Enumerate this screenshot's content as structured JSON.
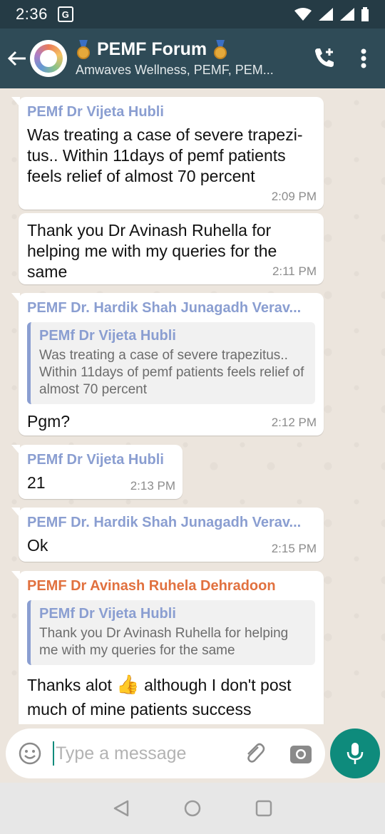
{
  "status_bar": {
    "time": "2:36"
  },
  "header": {
    "title": "PEMF Forum",
    "subtitle": "Amwaves Wellness, PEMF, PEM..."
  },
  "messages": [
    {
      "sender": "PEMf Dr Vijeta Hubli",
      "text": "Was treating a case of severe trapezi-tus..  Within 11days of pemf patients feels relief of almost 70 percent",
      "time": "2:09 PM"
    },
    {
      "text": "Thank you Dr Avinash Ruhella for helping me with my queries for the same",
      "time": "2:11 PM"
    },
    {
      "sender": "PEMF Dr. Hardik Shah Junagadh Verav...",
      "quote_sender": "PEMf Dr Vijeta Hubli",
      "quote_text": "Was treating a case of severe trapezitus.. Within 11days of pemf patients feels relief of almost 70 percent",
      "text": "Pgm?",
      "time": "2:12 PM"
    },
    {
      "sender": "PEMf Dr Vijeta Hubli",
      "text": "21",
      "time": "2:13 PM"
    },
    {
      "sender": "PEMF Dr. Hardik Shah Junagadh Verav...",
      "text": "Ok",
      "time": "2:15 PM"
    },
    {
      "sender": "PEMF Dr Avinash Ruhela Dehradoon",
      "quote_sender": "PEMf Dr Vijeta Hubli",
      "quote_text": "Thank you Dr Avinash Ruhella for helping me with my queries for the same",
      "text_before_emoji": "Thanks alot",
      "text_after_emoji": "although I don't post much of mine patients success"
    }
  ],
  "composer": {
    "placeholder": "Type a message"
  },
  "colors": {
    "header": "#2f4b57",
    "accent": "#0e8b7c",
    "sender_blue": "#8a9ed1",
    "sender_orange": "#e1713f"
  },
  "icons": [
    "back-arrow-icon",
    "medal-icon",
    "add-call-icon",
    "more-vert-icon",
    "emoji-icon",
    "attach-icon",
    "camera-icon",
    "mic-icon",
    "nav-back-icon",
    "nav-home-icon",
    "nav-recents-icon"
  ]
}
